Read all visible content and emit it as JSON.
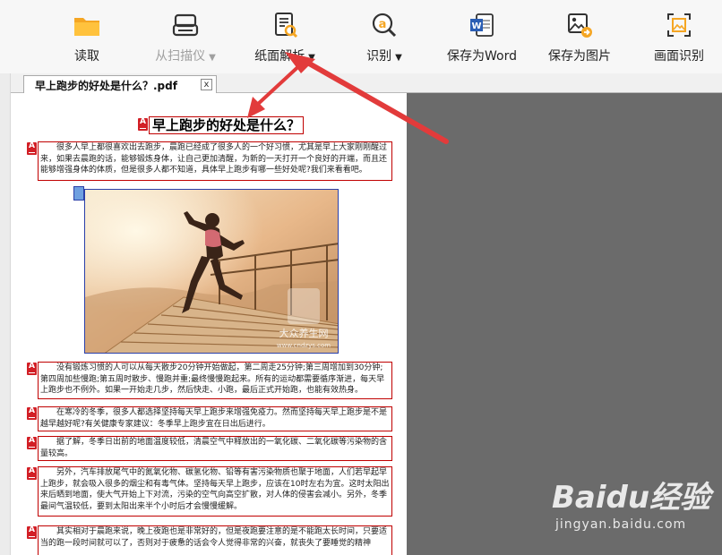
{
  "toolbar": {
    "items": [
      {
        "label": "读取",
        "icon": "folder-icon"
      },
      {
        "label": "从扫描仪",
        "caret": "▼",
        "icon": "scanner-icon",
        "disabled": true
      },
      {
        "label": "纸面解析",
        "caret": "▼",
        "icon": "document-search-icon"
      },
      {
        "label": "识别",
        "caret": "▼",
        "icon": "ocr-search-icon"
      },
      {
        "label": "保存为Word",
        "icon": "word-icon"
      },
      {
        "label": "保存为图片",
        "icon": "save-image-icon"
      },
      {
        "label": "画面识别",
        "icon": "screen-capture-icon"
      }
    ]
  },
  "tab": {
    "title": "早上跑步的好处是什么？.pdf",
    "close": "x"
  },
  "document": {
    "title": "早上跑步的好处是什么？",
    "mark_glyph": "A",
    "paragraphs": [
      "很多人早上都很喜欢出去跑步，晨跑已经成了很多人的一个好习惯，尤其是早上大家刚刚醒过来，如果去晨跑的话，能够锻炼身体，让自己更加清醒，为新的一天打开一个良好的开端，而且还能够增强身体的体质，但是很多人都不知道，具体早上跑步有哪一些好处呢?我们来看看吧。",
      "没有锻炼习惯的人可以从每天散步20分钟开始做起，第二周走25分钟;第三周增加到30分钟;第四周加些慢跑;第五周时散步、慢跑并重;最终慢慢跑起来。所有的运动都需要循序渐进，每天早上跑步也不例外。如果一开始走几步，然后快走、小跑，最后正式开始跑，也能有效热身。",
      "在寒冷的冬季，很多人都选择坚持每天早上跑步来增强免疫力。然而坚持每天早上跑步是不是越早越好呢?有关健康专家建议：冬季早上跑步宜在日出后进行。",
      "据了解，冬季日出前的地面温度较低，清晨空气中释放出的一氧化碳、二氧化碳等污染物的含量较高。",
      "另外，汽车排放尾气中的氮氧化物、碳氢化物、铅等有害污染物质也聚于地面，人们若早起早上跑步，就会吸入很多的烟尘和有毒气体。坚持每天早上跑步，应该在10时左右为宜。这时太阳出来后晒到地面，使大气开始上下对流，污染的空气向高空扩散，对人体的侵害会减小。另外，冬季最间气温较低，要到太阳出来半个小时后才会慢慢缓解。",
      "其实相对于晨跑来说，晚上夜跑也是非常好的，但是夜跑要注意的是不能跑太长时间，只要适当的跑一段时间就可以了，否则对于疲惫的话会令人觉得非常的兴奋，就丧失了要睡觉的精神"
    ]
  },
  "image": {
    "watermark_top": "大众养生网",
    "watermark_url": "www.cndzys.com"
  },
  "watermark": {
    "logo": "Baidu经验",
    "url": "jingyan.baidu.com"
  },
  "colors": {
    "mark_red": "#d21f26",
    "arrow_red": "#e23b3b",
    "frame_blue": "#2a3fa8"
  }
}
